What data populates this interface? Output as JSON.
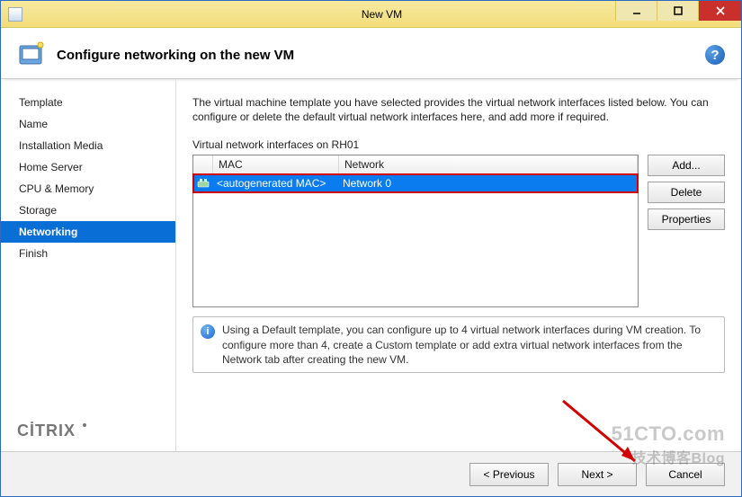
{
  "window": {
    "title": "New VM"
  },
  "header": {
    "title": "Configure networking on the new VM"
  },
  "sidebar": {
    "steps": [
      {
        "label": "Template",
        "active": false
      },
      {
        "label": "Name",
        "active": false
      },
      {
        "label": "Installation Media",
        "active": false
      },
      {
        "label": "Home Server",
        "active": false
      },
      {
        "label": "CPU & Memory",
        "active": false
      },
      {
        "label": "Storage",
        "active": false
      },
      {
        "label": "Networking",
        "active": true
      },
      {
        "label": "Finish",
        "active": false
      }
    ],
    "brand": "CİTRIX"
  },
  "main": {
    "description": "The virtual machine template you have selected provides the virtual network interfaces listed below. You can configure or delete the default virtual network interfaces here, and add more if required.",
    "list_label": "Virtual network interfaces on RH01",
    "columns": {
      "mac": "MAC",
      "network": "Network"
    },
    "rows": [
      {
        "mac": "<autogenerated MAC>",
        "network": "Network 0"
      }
    ],
    "buttons": {
      "add": "Add...",
      "delete": "Delete",
      "properties": "Properties"
    },
    "info": "Using a Default template, you can configure up to 4 virtual network interfaces during VM creation. To configure more than 4, create a Custom template or add extra virtual network interfaces from the Network tab after creating the new VM."
  },
  "footer": {
    "previous": "< Previous",
    "next": "Next >",
    "cancel": "Cancel"
  },
  "overlay": {
    "watermark_line1": "51CTO.com",
    "watermark_line2": "技术博客Blog"
  }
}
